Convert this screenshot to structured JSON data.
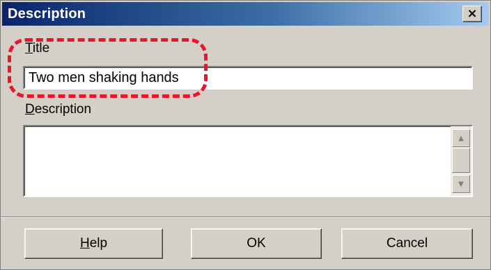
{
  "window": {
    "title": "Description",
    "close_glyph": "×"
  },
  "title_field": {
    "label_mnemonic": "T",
    "label_rest": "itle",
    "value": "Two men shaking hands"
  },
  "description_field": {
    "label_mnemonic": "D",
    "label_rest": "escription",
    "value": ""
  },
  "scrollbar": {
    "up_glyph": "▲",
    "down_glyph": "▼"
  },
  "buttons": {
    "help_mnemonic": "H",
    "help_rest": "elp",
    "ok": "OK",
    "cancel": "Cancel"
  },
  "colors": {
    "titlebar_start": "#0a246a",
    "titlebar_end": "#a6caf0",
    "highlight": "#e8162a",
    "face": "#d4d0c8"
  }
}
